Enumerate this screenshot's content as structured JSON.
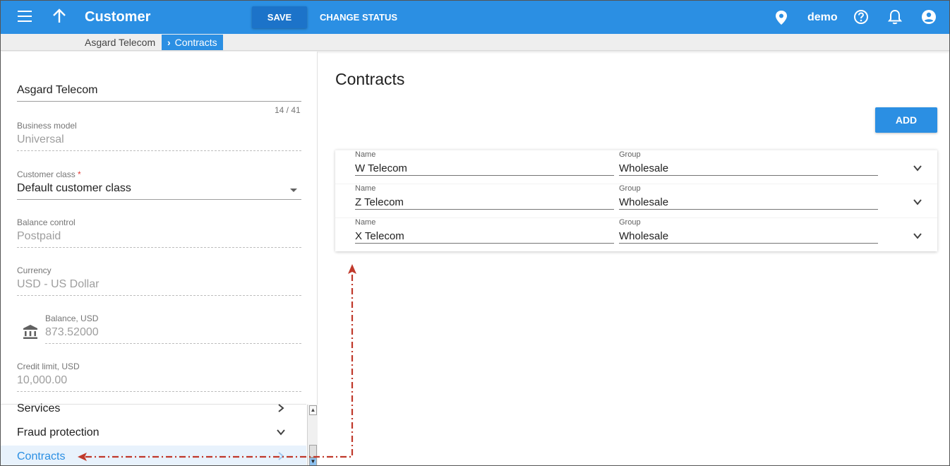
{
  "header": {
    "title": "Customer",
    "save_label": "SAVE",
    "change_status_label": "CHANGE STATUS",
    "user": "demo"
  },
  "breadcrumb": {
    "parent": "Asgard Telecom",
    "current": "Contracts"
  },
  "left_panel": {
    "name": {
      "value": "Asgard Telecom",
      "counter": "14 / 41"
    },
    "business_model": {
      "label": "Business model",
      "value": "Universal"
    },
    "customer_class": {
      "label": "Customer class",
      "required_mark": "*",
      "value": "Default customer class"
    },
    "balance_control": {
      "label": "Balance control",
      "value": "Postpaid"
    },
    "currency": {
      "label": "Currency",
      "value": "USD - US Dollar"
    },
    "balance": {
      "label": "Balance, USD",
      "value": "873.52000"
    },
    "credit_limit": {
      "label": "Credit limit, USD",
      "value": "10,000.00"
    },
    "nav": [
      {
        "label": "Services"
      },
      {
        "label": "Fraud protection"
      },
      {
        "label": "Contracts"
      }
    ]
  },
  "main": {
    "title": "Contracts",
    "add_label": "ADD",
    "columns": {
      "name": "Name",
      "group": "Group"
    },
    "rows": [
      {
        "name": "W Telecom",
        "group": "Wholesale"
      },
      {
        "name": "Z Telecom",
        "group": "Wholesale"
      },
      {
        "name": "X Telecom",
        "group": "Wholesale"
      }
    ]
  },
  "colors": {
    "primary": "#2b8fe3",
    "save_button": "#1c73c9",
    "annotation_arrow": "#c0392b"
  },
  "icons": [
    "menu-icon",
    "arrow-up-icon",
    "location-pin-icon",
    "help-icon",
    "bell-icon",
    "account-icon",
    "bank-icon",
    "chevron-right-icon",
    "chevron-down-icon"
  ]
}
